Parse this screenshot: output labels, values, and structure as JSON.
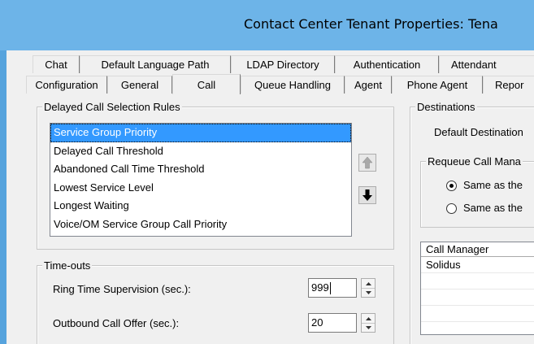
{
  "window": {
    "title": "Contact Center Tenant Properties: Tena"
  },
  "tabs_row1": [
    "Chat",
    "Default Language Path",
    "LDAP Directory",
    "Authentication",
    "Attendant"
  ],
  "tabs_row2": [
    "Configuration",
    "General",
    "Call",
    "Queue Handling",
    "Agent",
    "Phone Agent",
    "Repor"
  ],
  "active_tab": "Call",
  "delayed_call": {
    "label": "Delayed Call Selection Rules",
    "items": [
      "Service Group Priority",
      "Delayed Call Threshold",
      "Abandoned Call Time Threshold",
      "Lowest Service Level",
      "Longest Waiting",
      "Voice/OM Service Group Call Priority"
    ],
    "selected_index": 0
  },
  "timeouts": {
    "label": "Time-outs",
    "ring_label": "Ring Time Supervision (sec.):",
    "ring_value": "999",
    "outbound_label": "Outbound Call Offer (sec.):",
    "outbound_value": "20"
  },
  "destinations": {
    "label": "Destinations",
    "default_label": "Default Destination",
    "requeue": {
      "label": "Requeue Call Mana",
      "options": [
        "Same as the",
        "Same as the"
      ],
      "selected_index": 0
    },
    "grid": {
      "header": "Call Manager",
      "rows": [
        "Solidus"
      ]
    }
  },
  "icons": {
    "move_up": "arrow-up-icon",
    "move_down": "arrow-down-icon"
  }
}
